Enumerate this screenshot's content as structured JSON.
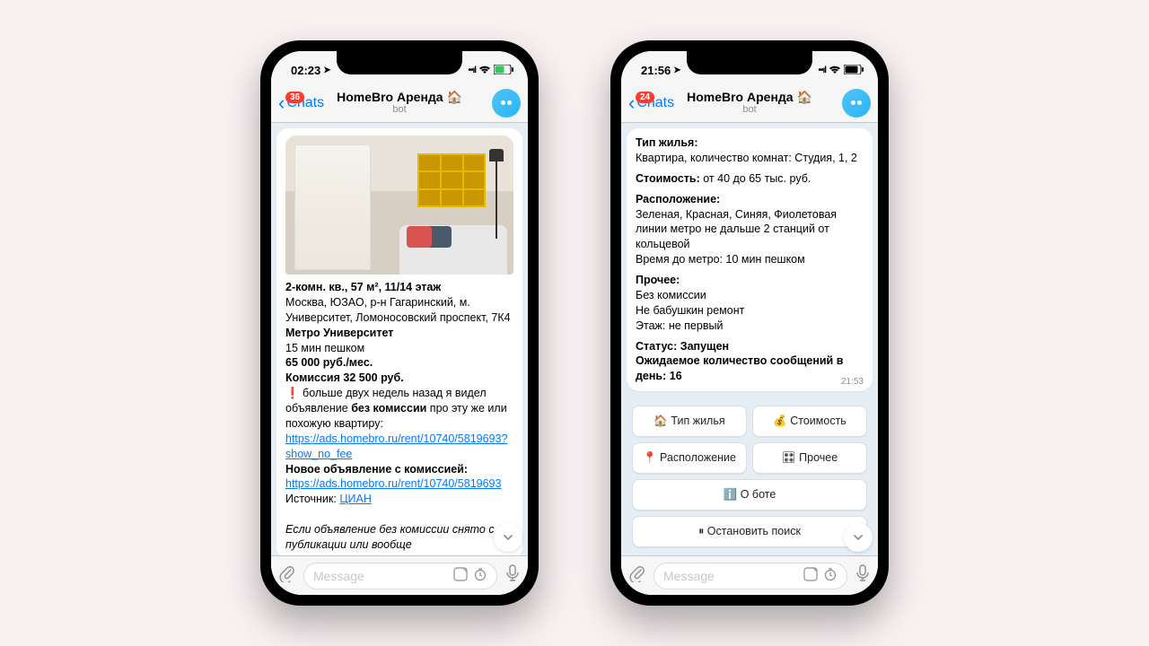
{
  "phones": [
    {
      "status_time": "02:23",
      "badge": "36",
      "back_label": "Chats",
      "title": "HomeBro Аренда 🏠",
      "subtitle": "bot",
      "input_placeholder": "Message",
      "listing": {
        "title": "2-комн. кв., 57 м², 11/14 этаж",
        "address": "Москва, ЮЗАО, р-н Гагаринский, м. Университет, Ломоносовский проспект, 7К4",
        "metro_title": "Метро Университет",
        "walk": "15 мин пешком",
        "price": "65 000 руб./мес.",
        "commission": "Комиссия 32 500 руб.",
        "warn_prefix": "❗️ больше двух недель назад я видел объявление",
        "warn_bold": " без комиссии",
        "warn_suffix": " про эту же или похожую квартиру:",
        "link1": "https://ads.homebro.ru/rent/10740/5819693?show_no_fee",
        "new_ad_label": "Новое объявление с комиссией:",
        "link2": "https://ads.homebro.ru/rent/10740/5819693",
        "source_label": "Источник: ",
        "source_name": "ЦИАН",
        "note": "Если объявление без комиссии снято с публикации или вообще"
      }
    },
    {
      "status_time": "21:56",
      "badge": "24",
      "back_label": "Chats",
      "title": "HomeBro Аренда 🏠",
      "subtitle": "bot",
      "input_placeholder": "Message",
      "msg_time": "21:53",
      "filters": {
        "type_label": "Тип жилья:",
        "type_text": "Квартира, количество комнат: Студия, 1, 2",
        "price_label": "Стоимость:",
        "price_text": " от 40 до 65 тыс. руб.",
        "loc_label": "Расположение:",
        "loc_text": "Зеленая, Красная, Синяя, Фиолетовая линии метро не дальше 2 станций от кольцевой",
        "loc_walk": "Время до метро: 10 мин пешком",
        "other_label": "Прочее:",
        "other1": "Без комиссии",
        "other2": "Не бабушкин ремонт",
        "other3": "Этаж: не первый",
        "status": "Статус: Запущен",
        "expected": "Ожидаемое количество сообщений в день: 16"
      },
      "buttons": {
        "type": "🏠 Тип жилья",
        "price": "💰 Стоимость",
        "location": "📍 Расположение",
        "other": "🎛 Прочее",
        "about": "ℹ️ О боте",
        "stop": "⏸ Остановить поиск"
      }
    }
  ]
}
